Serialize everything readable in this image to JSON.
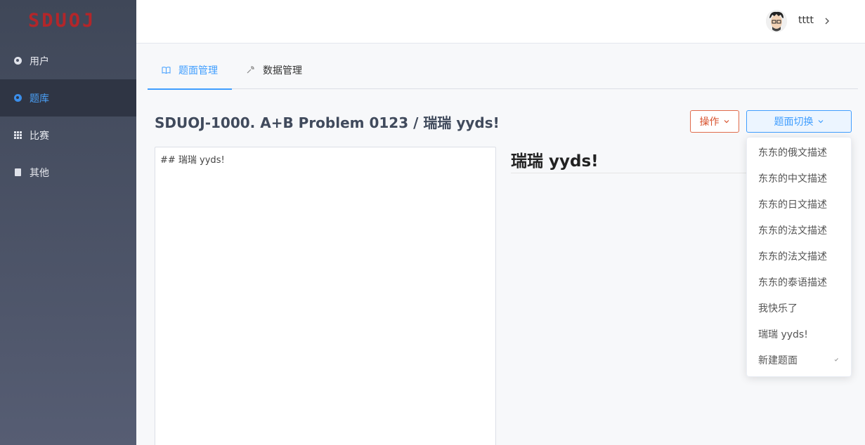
{
  "app": {
    "logo_text": "SDUOJ"
  },
  "sidebar": {
    "items": [
      {
        "label": "用户",
        "icon": "user-circle-icon",
        "active": false
      },
      {
        "label": "题库",
        "icon": "problem-circle-icon",
        "active": true
      },
      {
        "label": "比赛",
        "icon": "grid-icon",
        "active": false
      },
      {
        "label": "其他",
        "icon": "document-icon",
        "active": false
      }
    ]
  },
  "header": {
    "username": "tttt"
  },
  "tabs": [
    {
      "label": "题面管理",
      "icon": "book-icon",
      "active": true
    },
    {
      "label": "数据管理",
      "icon": "wrench-icon",
      "active": false
    }
  ],
  "problem": {
    "title": "SDUOJ-1000. A+B Problem 0123 / 瑞瑞 yyds!"
  },
  "toolbar": {
    "operate_label": "操作",
    "switch_label": "题面切换"
  },
  "editor": {
    "content": "## 瑞瑞 yyds!"
  },
  "preview": {
    "heading": "瑞瑞 yyds!"
  },
  "dropdown": {
    "items": [
      {
        "label": "东东的俄文描述"
      },
      {
        "label": "东东的中文描述"
      },
      {
        "label": "东东的日文描述"
      },
      {
        "label": "东东的法文描述"
      },
      {
        "label": "东东的法文描述"
      },
      {
        "label": "东东的泰语描述"
      },
      {
        "label": "我快乐了"
      },
      {
        "label": "瑞瑞 yyds!"
      },
      {
        "label": "新建题面",
        "selected": true
      }
    ]
  },
  "colors": {
    "accent": "#409eff",
    "danger": "#d8532f",
    "logo": "#b3262a",
    "sidebar_active_bg": "#2f3544"
  }
}
